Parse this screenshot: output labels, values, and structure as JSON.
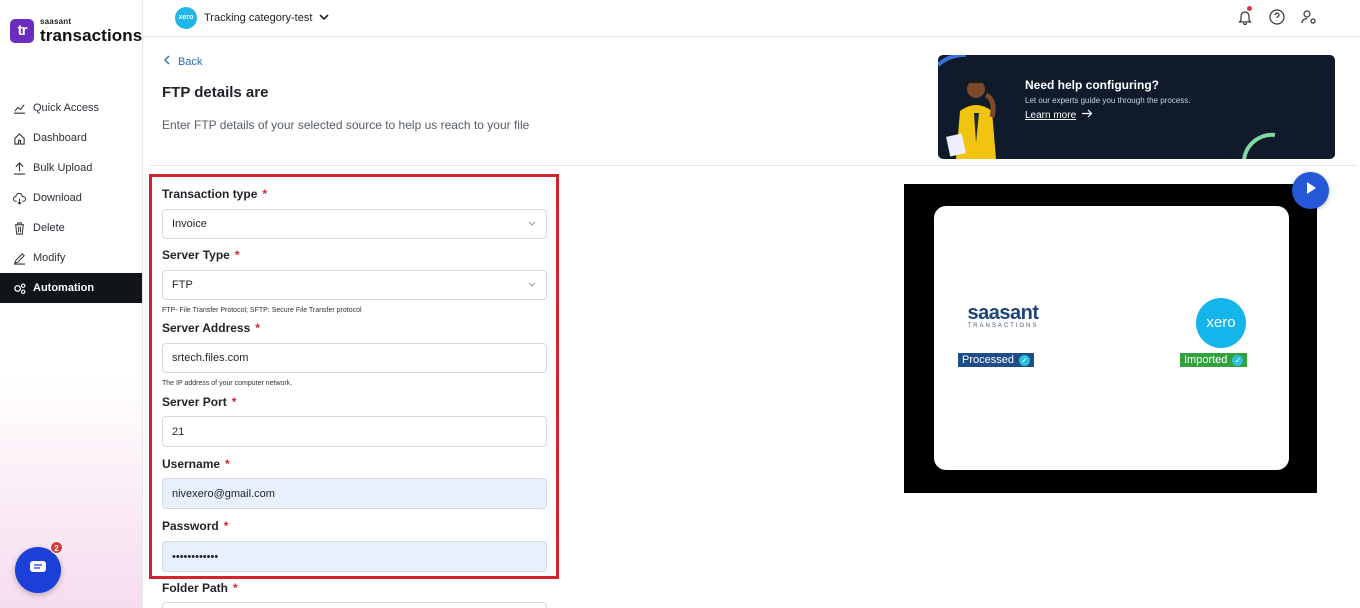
{
  "brand": {
    "mark": "tr",
    "small": "saasant",
    "big": "transactions"
  },
  "sidebar": {
    "items": [
      {
        "label": "Quick Access",
        "icon": "chart-line-icon"
      },
      {
        "label": "Dashboard",
        "icon": "home-icon"
      },
      {
        "label": "Bulk Upload",
        "icon": "upload-icon"
      },
      {
        "label": "Download",
        "icon": "cloud-download-icon"
      },
      {
        "label": "Delete",
        "icon": "trash-icon"
      },
      {
        "label": "Modify",
        "icon": "edit-icon"
      },
      {
        "label": "Automation",
        "icon": "gears-icon",
        "active": true
      }
    ],
    "chat_badge": "2"
  },
  "topbar": {
    "org_logo": "xero",
    "org_name": "Tracking category-test",
    "icons": [
      "bell-icon",
      "help-icon",
      "user-settings-icon"
    ]
  },
  "page": {
    "back": "Back",
    "title": "FTP details are",
    "subtitle": "Enter FTP details of your selected source to help us reach to your file"
  },
  "help_card": {
    "title": "Need help configuring?",
    "subtitle": "Let our experts guide you through the process.",
    "link": "Learn more"
  },
  "video": {
    "saasant_word": "saasant",
    "saasant_tag": "TRANSACTIONS",
    "processed": "Processed",
    "xero": "xero",
    "imported": "Imported"
  },
  "form": {
    "transaction_type": {
      "label": "Transaction type",
      "value": "Invoice"
    },
    "server_type": {
      "label": "Server Type",
      "value": "FTP",
      "hint": "FTP- File Transfer Protocol; SFTP: Secure File Transfer protocol"
    },
    "server_address": {
      "label": "Server Address",
      "value": "srtech.files.com",
      "hint": "The IP address of your computer network."
    },
    "server_port": {
      "label": "Server Port",
      "value": "21"
    },
    "username": {
      "label": "Username",
      "value": "nivexero@gmail.com"
    },
    "password": {
      "label": "Password",
      "value": "••••••••••••"
    },
    "folder_path": {
      "label": "Folder Path"
    },
    "required_mark": "*"
  },
  "colors": {
    "accent": "#1c3fd8",
    "highlight": "#d1242f",
    "active_nav": "#111418"
  }
}
